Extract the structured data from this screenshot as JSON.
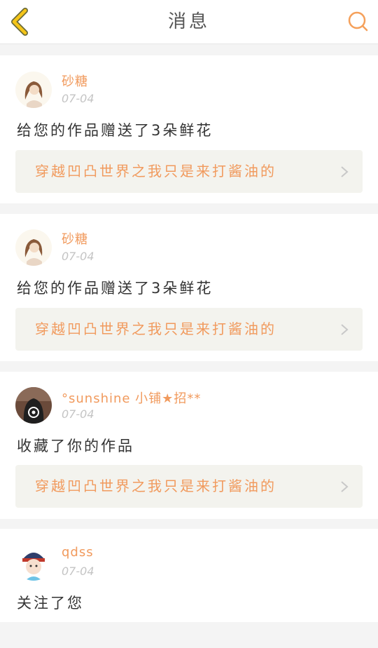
{
  "header": {
    "title": "消息",
    "back_icon": "chevron-left-icon",
    "search_icon": "search-icon",
    "accent": "#f5a623"
  },
  "messages": [
    {
      "user": "砂糖",
      "date": "07-04",
      "text": "给您的作品赠送了3朵鲜花",
      "work_title": "穿越凹凸世界之我只是来打酱油的"
    },
    {
      "user": "砂糖",
      "date": "07-04",
      "text": "给您的作品赠送了3朵鲜花",
      "work_title": "穿越凹凸世界之我只是来打酱油的"
    },
    {
      "user": "°sunshine 小铺★招**",
      "date": "07-04",
      "text": "收藏了你的作品",
      "work_title": "穿越凹凸世界之我只是来打酱油的"
    },
    {
      "user": "qdss",
      "date": "07-04",
      "text": "关注了您"
    }
  ],
  "colors": {
    "username": "#f19a5d",
    "date": "#c4c4c4",
    "work_bg": "#f3f3ee",
    "page_bg": "#f4f4f4"
  }
}
